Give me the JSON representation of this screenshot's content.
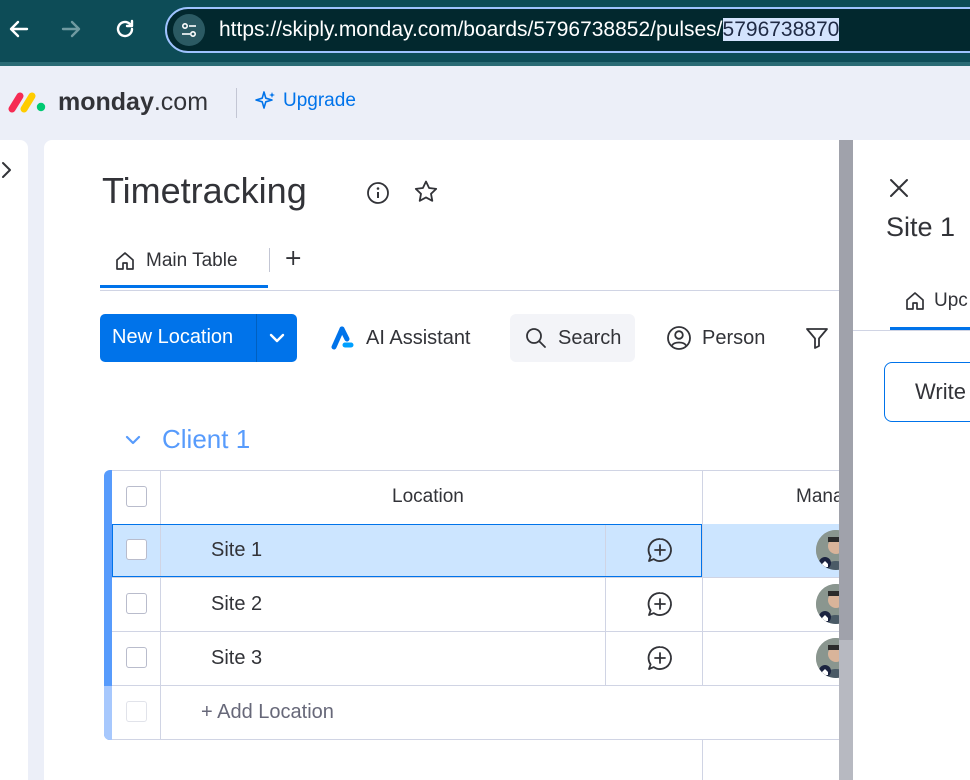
{
  "browser": {
    "url_prefix": "https://skiply.monday.com/boards/5796738852/pulses/",
    "url_selected": "5796738870"
  },
  "header": {
    "logo_bold": "monday",
    "logo_suffix": ".com",
    "upgrade_label": "Upgrade"
  },
  "board": {
    "title": "Timetracking",
    "tabs": [
      {
        "label": "Main Table"
      }
    ],
    "add_tab_label": "+",
    "toolbar": {
      "new_label": "New Location",
      "ai_label": "AI Assistant",
      "search_label": "Search",
      "person_label": "Person"
    },
    "group": {
      "name": "Client 1",
      "color": "#579bfc",
      "columns": [
        "Location",
        "Mana"
      ],
      "rows": [
        {
          "name": "Site 1"
        },
        {
          "name": "Site 2"
        },
        {
          "name": "Site 3"
        }
      ],
      "add_label": "+ Add Location"
    }
  },
  "side_panel": {
    "title": "Site 1",
    "tab_label": "Upc",
    "write_placeholder": "Write"
  },
  "colors": {
    "accent": "#0073ea",
    "browser_bg": "#0d4c57",
    "selected_row": "#cce5ff"
  }
}
